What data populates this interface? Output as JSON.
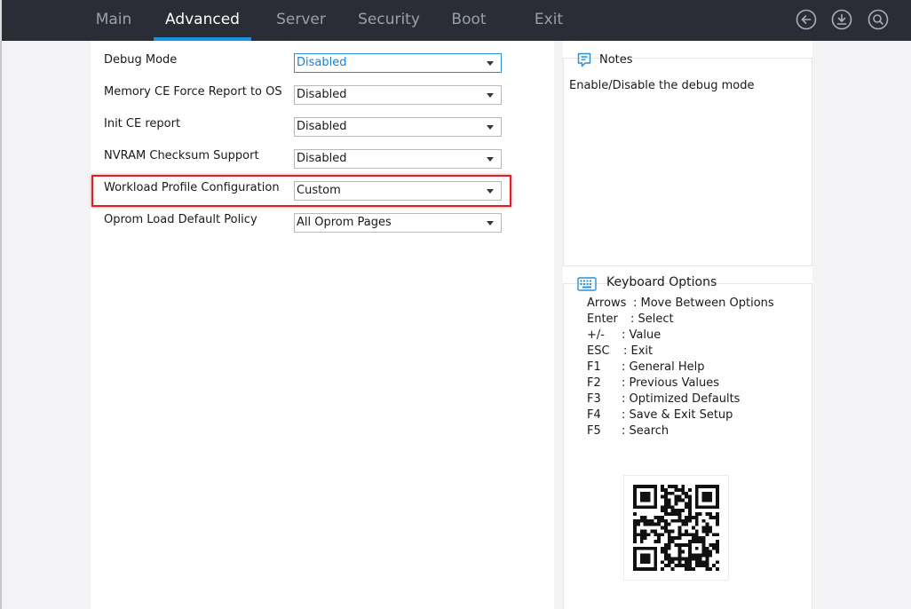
{
  "nav": {
    "tabs": [
      {
        "label": "Main"
      },
      {
        "label": "Advanced"
      },
      {
        "label": "Server"
      },
      {
        "label": "Security"
      },
      {
        "label": "Boot"
      },
      {
        "label": "Exit"
      }
    ],
    "active_tab": "Advanced",
    "icons": [
      "back-arrow-icon",
      "download-icon",
      "search-icon"
    ]
  },
  "settings": [
    {
      "label": "Debug Mode",
      "value": "Disabled"
    },
    {
      "label": "Memory CE Force Report to OS",
      "value": "Disabled"
    },
    {
      "label": "Init CE report",
      "value": "Disabled"
    },
    {
      "label": "NVRAM Checksum Support",
      "value": "Disabled"
    },
    {
      "label": "Workload Profile Configuration",
      "value": "Custom"
    },
    {
      "label": "Oprom Load Default Policy",
      "value": "All Oprom Pages"
    }
  ],
  "notes": {
    "title": "Notes",
    "text": "Enable/Disable the debug mode"
  },
  "keyboard": {
    "title": "Keyboard Options",
    "lines": [
      {
        "key": "Arrows",
        "desc": ": Move Between Options"
      },
      {
        "key": "Enter",
        "desc": ": Select"
      },
      {
        "key": "+/-",
        "desc": ": Value"
      },
      {
        "key": "ESC",
        "desc": ": Exit"
      },
      {
        "key": "F1",
        "desc": ": General Help"
      },
      {
        "key": "F2",
        "desc": ": Previous Values"
      },
      {
        "key": "F3",
        "desc": ": Optimized Defaults"
      },
      {
        "key": "F4",
        "desc": ": Save & Exit Setup"
      },
      {
        "key": "F5",
        "desc": ": Search"
      }
    ]
  },
  "colors": {
    "topbar": "#2b2d36",
    "accent": "#1e90e0",
    "highlight": "#e02020"
  }
}
